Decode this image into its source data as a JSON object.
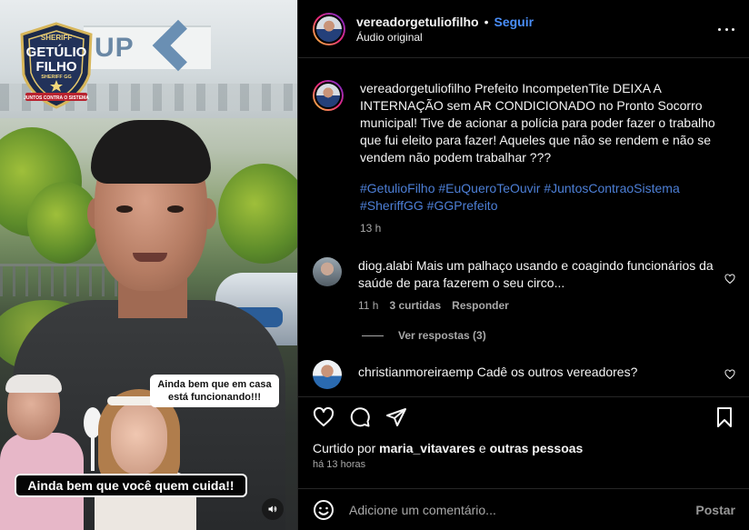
{
  "video": {
    "logo_text": {
      "top": "SHERIFF",
      "name1": "GETÚLIO",
      "name2": "FILHO",
      "middle": "SHERIFF GG",
      "bottom": "JUNTOS CONTRA O SISTEMA"
    },
    "caption_small": "Ainda bem que em casa está funcionando!!!",
    "caption_big": "Ainda bem que você quem cuida!!",
    "sound_icon": "speaker-icon"
  },
  "header": {
    "username": "vereadorgetuliofilho",
    "separator": "•",
    "follow_label": "Seguir",
    "audio_label": "Áudio original",
    "more_icon": "more-horizontal-icon"
  },
  "caption": {
    "username": "vereadorgetuliofilho",
    "text": "Prefeito IncompetenTite DEIXA A INTERNAÇÃO sem AR CONDICIONADO no Pronto Socorro municipal! Tive de acionar a polícia para poder fazer o trabalho que fui eleito para fazer! Aqueles que não se rendem e não se vendem não podem trabalhar ???",
    "hashtags": "#GetulioFilho #EuQueroTeOuvir #JuntosContraoSistema #SheriffGG #GGPrefeito",
    "time": "13 h"
  },
  "comments": [
    {
      "username": "diog.alabi",
      "text": "Mais um palhaço usando e coagindo funcionários da saúde de para fazerem o seu circo...",
      "time": "11 h",
      "likes": "3 curtidas",
      "reply_label": "Responder",
      "view_replies": "Ver respostas (3)"
    },
    {
      "username": "christianmoreiraemp",
      "text": "Cadê os outros vereadores?"
    }
  ],
  "actions": {
    "liked_prefix": "Curtido por",
    "liked_user": "maria_vitavares",
    "liked_conj": "e",
    "liked_others": "outras pessoas",
    "ago": "há 13 horas"
  },
  "add_comment": {
    "placeholder": "Adicione um comentário...",
    "post_label": "Postar"
  },
  "colors": {
    "background": "#000000",
    "link_blue": "#4a8ef8",
    "hashtag_blue": "#4d7fd6",
    "muted": "#a8a8a8"
  }
}
